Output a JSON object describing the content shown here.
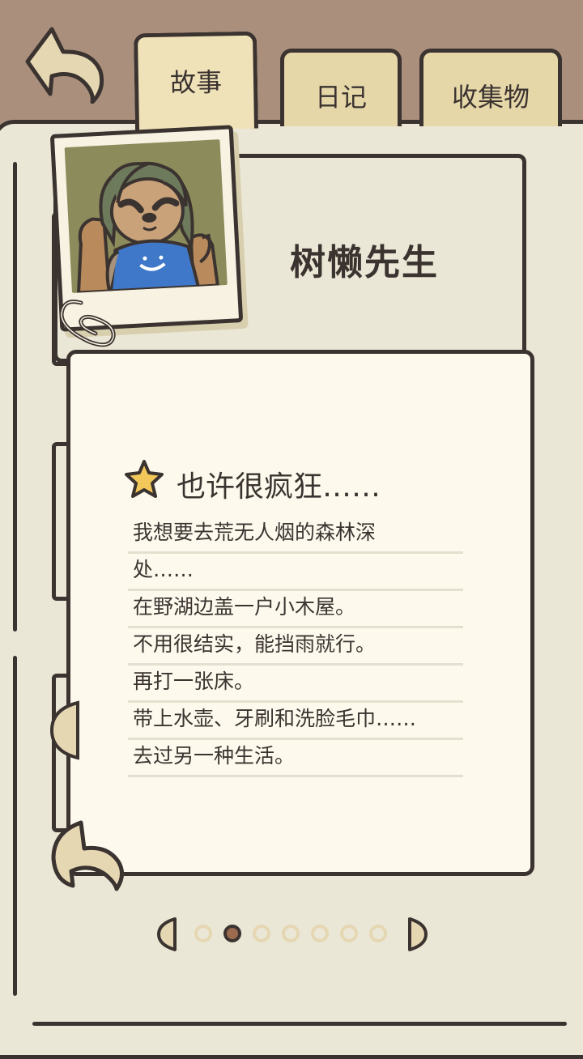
{
  "header": {
    "tabs": [
      {
        "label": "故事",
        "active": true
      },
      {
        "label": "日记",
        "active": false
      },
      {
        "label": "收集物",
        "active": false
      }
    ]
  },
  "character": {
    "name": "树懒先生"
  },
  "story": {
    "title": "也许很疯狂……",
    "lines": [
      "我想要去荒无人烟的森林深",
      "处……",
      "在野湖边盖一户小木屋。",
      "不用很结实，能挡雨就行。",
      "再打一张床。",
      "带上水壶、牙刷和洗脸毛巾……",
      "去过另一种生活。"
    ]
  },
  "pager": {
    "total": 7,
    "current": 2
  },
  "colors": {
    "background": "#a98f7c",
    "outline": "#3b3330",
    "tab": "#e6d7a9",
    "page": "#ebe7d6",
    "note": "#fdfaed",
    "star": "#f2c85a",
    "active_dot": "#9b6a4f"
  }
}
